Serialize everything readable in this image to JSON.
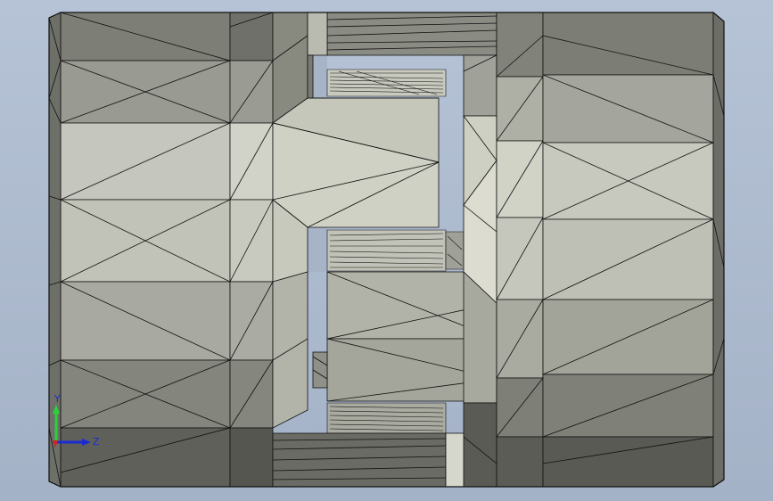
{
  "viewport": {
    "background_top": "#b6c3d6",
    "background_bottom": "#a4b2c7",
    "model_edge_color": "#111111"
  },
  "triad": {
    "y_label": "Y",
    "z_label": "Z",
    "y_color": "#2bd13b",
    "z_color": "#1b2bd0",
    "x_color": "#d81f1f"
  }
}
